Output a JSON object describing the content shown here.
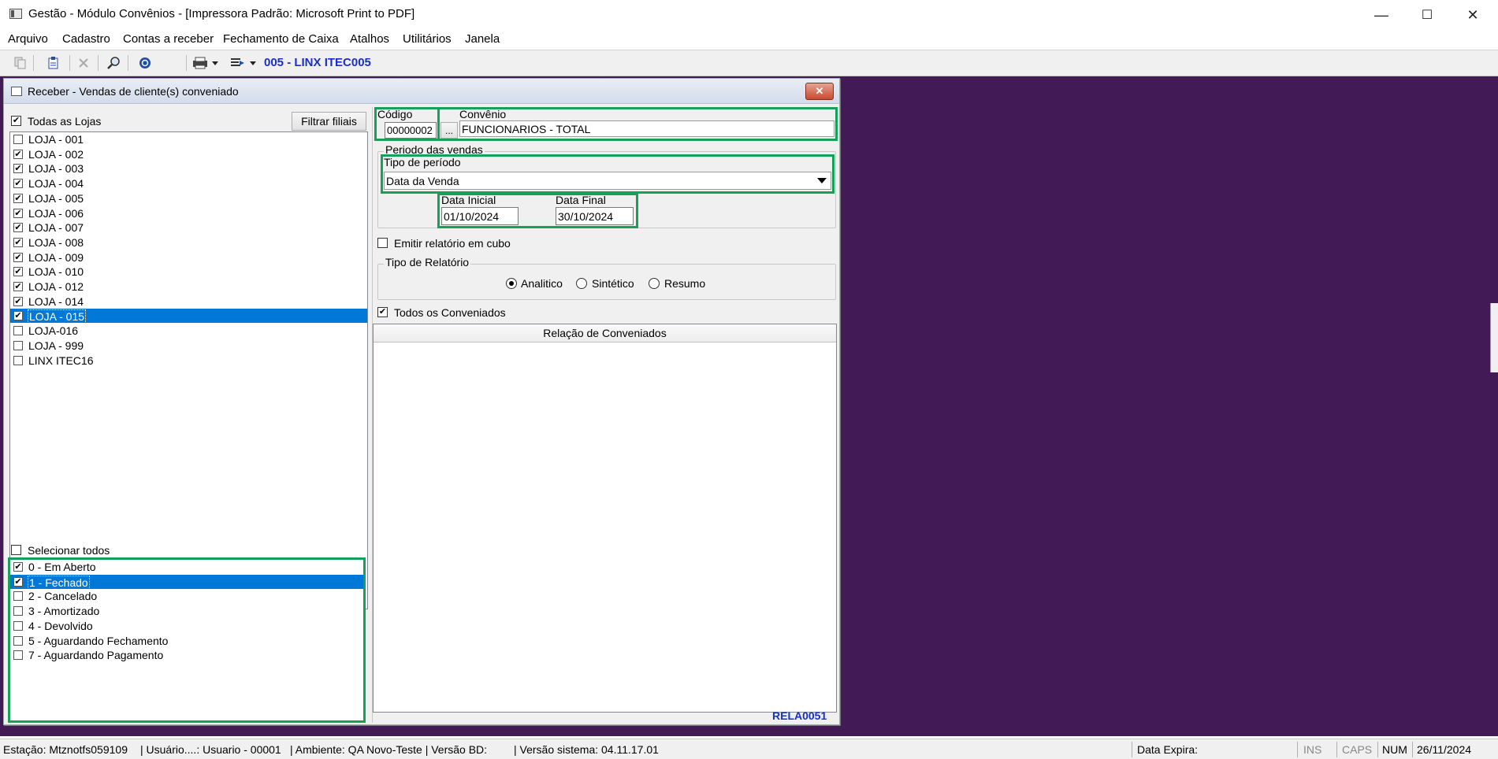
{
  "window": {
    "title": "Gestão  - Módulo Convênios - [Impressora Padrão: Microsoft Print to PDF]",
    "minimize": "—",
    "maximize": "☐",
    "close": "✕"
  },
  "menu": [
    "Arquivo",
    "Cadastro",
    "Contas a receber",
    "Fechamento de Caixa",
    "Atalhos",
    "Utilitários",
    "Janela"
  ],
  "toolbar": {
    "branch": "005 - LINX ITEC005",
    "icons": [
      "copy-icon",
      "paste-icon",
      "delete-icon",
      "search-icon",
      "power-icon",
      "print-icon",
      "export-icon"
    ]
  },
  "dialog": {
    "title": "Receber - Vendas de cliente(s) conveniado",
    "close_label": "✕",
    "stores": {
      "all_label": "Todas as Lojas",
      "all_checked": true,
      "filter_button": "Filtrar filiais",
      "items": [
        {
          "label": "LOJA - 001",
          "checked": false,
          "selected": false
        },
        {
          "label": "LOJA - 002",
          "checked": true,
          "selected": false
        },
        {
          "label": "LOJA - 003",
          "checked": true,
          "selected": false
        },
        {
          "label": "LOJA - 004",
          "checked": true,
          "selected": false
        },
        {
          "label": "LOJA - 005",
          "checked": true,
          "selected": false
        },
        {
          "label": "LOJA - 006",
          "checked": true,
          "selected": false
        },
        {
          "label": "LOJA - 007",
          "checked": true,
          "selected": false
        },
        {
          "label": "LOJA - 008",
          "checked": true,
          "selected": false
        },
        {
          "label": "LOJA - 009",
          "checked": true,
          "selected": false
        },
        {
          "label": "LOJA - 010",
          "checked": true,
          "selected": false
        },
        {
          "label": "LOJA - 012",
          "checked": true,
          "selected": false
        },
        {
          "label": "LOJA - 014",
          "checked": true,
          "selected": false
        },
        {
          "label": "LOJA - 015",
          "checked": true,
          "selected": true
        },
        {
          "label": "LOJA-016",
          "checked": false,
          "selected": false
        },
        {
          "label": "LOJA - 999",
          "checked": false,
          "selected": false
        },
        {
          "label": "LINX ITEC16",
          "checked": false,
          "selected": false
        }
      ]
    },
    "status": {
      "select_all_label": "Selecionar todos",
      "select_all_checked": false,
      "items": [
        {
          "label": "0 - Em Aberto",
          "checked": true,
          "selected": false
        },
        {
          "label": "1 - Fechado",
          "checked": true,
          "selected": true
        },
        {
          "label": "2 - Cancelado",
          "checked": false,
          "selected": false
        },
        {
          "label": "3 - Amortizado",
          "checked": false,
          "selected": false
        },
        {
          "label": "4 - Devolvido",
          "checked": false,
          "selected": false
        },
        {
          "label": "5 - Aguardando Fechamento",
          "checked": false,
          "selected": false
        },
        {
          "label": "7 - Aguardando Pagamento",
          "checked": false,
          "selected": false
        }
      ]
    },
    "codigo": {
      "label": "Código",
      "value": "00000002",
      "lookup": "..."
    },
    "convenio": {
      "label": "Convênio",
      "value": "FUNCIONARIOS - TOTAL"
    },
    "periodo": {
      "group_label": "Periodo das vendas",
      "tipo_label": "Tipo de período",
      "tipo_value": "Data da Venda",
      "data_inicial_label": "Data Inicial",
      "data_inicial": "01/10/2024",
      "data_final_label": "Data Final",
      "data_final": "30/10/2024"
    },
    "cubo": {
      "label": "Emitir relatório em cubo",
      "checked": false
    },
    "relatorio": {
      "group_label": "Tipo de Relatório",
      "options": [
        {
          "label": "Analitico",
          "selected": true
        },
        {
          "label": "Sintético",
          "selected": false
        },
        {
          "label": "Resumo",
          "selected": false
        }
      ]
    },
    "conveniados": {
      "all_label": "Todos os Conveniados",
      "all_checked": true,
      "header": "Relação de Conveniados"
    },
    "report_code": "RELA0051"
  },
  "statusbar": {
    "estacao": "Estação: Mtznotfs059109",
    "usuario": "| Usuário....: Usuario - 00001",
    "ambiente": "| Ambiente: QA Novo-Teste | Versão BD:",
    "versao": "| Versão sistema: 04.11.17.01",
    "data_expira": "Data Expira:",
    "ins": "INS",
    "caps": "CAPS",
    "num": "NUM",
    "date": "26/11/2024"
  },
  "colors": {
    "mdi_background": "#421b56",
    "selection": "#0078d7",
    "highlight_frame": "#17a05a",
    "accent_text": "#1a2fc8"
  }
}
